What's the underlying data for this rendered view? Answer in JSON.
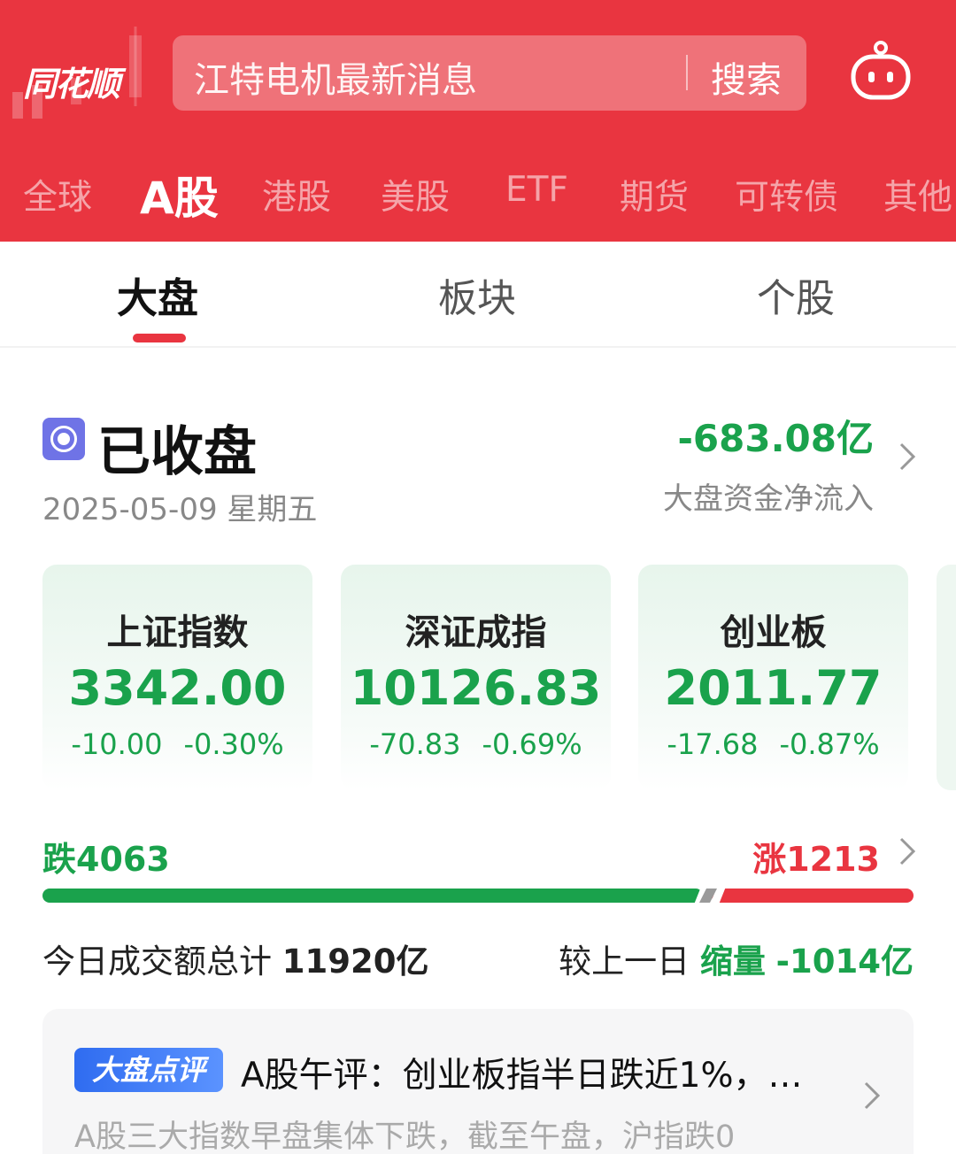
{
  "header": {
    "logo_text": "同花顺",
    "search_placeholder": "江特电机最新消息",
    "search_button": "搜索",
    "market_tabs": [
      {
        "label": "全球"
      },
      {
        "label": "A股",
        "active": true
      },
      {
        "label": "港股"
      },
      {
        "label": "美股"
      },
      {
        "label": "ETF"
      },
      {
        "label": "期货"
      },
      {
        "label": "可转债"
      },
      {
        "label": "其他"
      }
    ]
  },
  "sub_tabs": [
    {
      "label": "大盘",
      "active": true
    },
    {
      "label": "板块"
    },
    {
      "label": "个股"
    }
  ],
  "status": {
    "title": "已收盘",
    "date": "2025-05-09 星期五",
    "fund_flow_value": "-683.08亿",
    "fund_flow_label": "大盘资金净流入"
  },
  "indices": [
    {
      "name": "上证指数",
      "value": "3342.00",
      "change": "-10.00",
      "change_pct": "-0.30%"
    },
    {
      "name": "深证成指",
      "value": "10126.83",
      "change": "-70.83",
      "change_pct": "-0.69%"
    },
    {
      "name": "创业板",
      "value": "2011.77",
      "change": "-17.68",
      "change_pct": "-0.87%"
    }
  ],
  "breadth": {
    "fall_label": "跌4063",
    "rise_label": "涨1213",
    "fall_count": 4063,
    "rise_count": 1213
  },
  "turnover": {
    "label": "今日成交额总计",
    "value": "11920亿",
    "compare_label": "较上一日",
    "compare_state": "缩量",
    "compare_value": "-1014亿"
  },
  "news": {
    "badge": "大盘点评",
    "title": "A股午评：创业板指半日跌近1%，…",
    "body": "A股三大指数早盘集体下跌，截至午盘，沪指跌0"
  },
  "colors": {
    "brand_red": "#e93540",
    "down_green": "#1aa24c",
    "up_red": "#e93540",
    "status_purple": "#6f73e6",
    "badge_blue": "#2f6cf0"
  }
}
